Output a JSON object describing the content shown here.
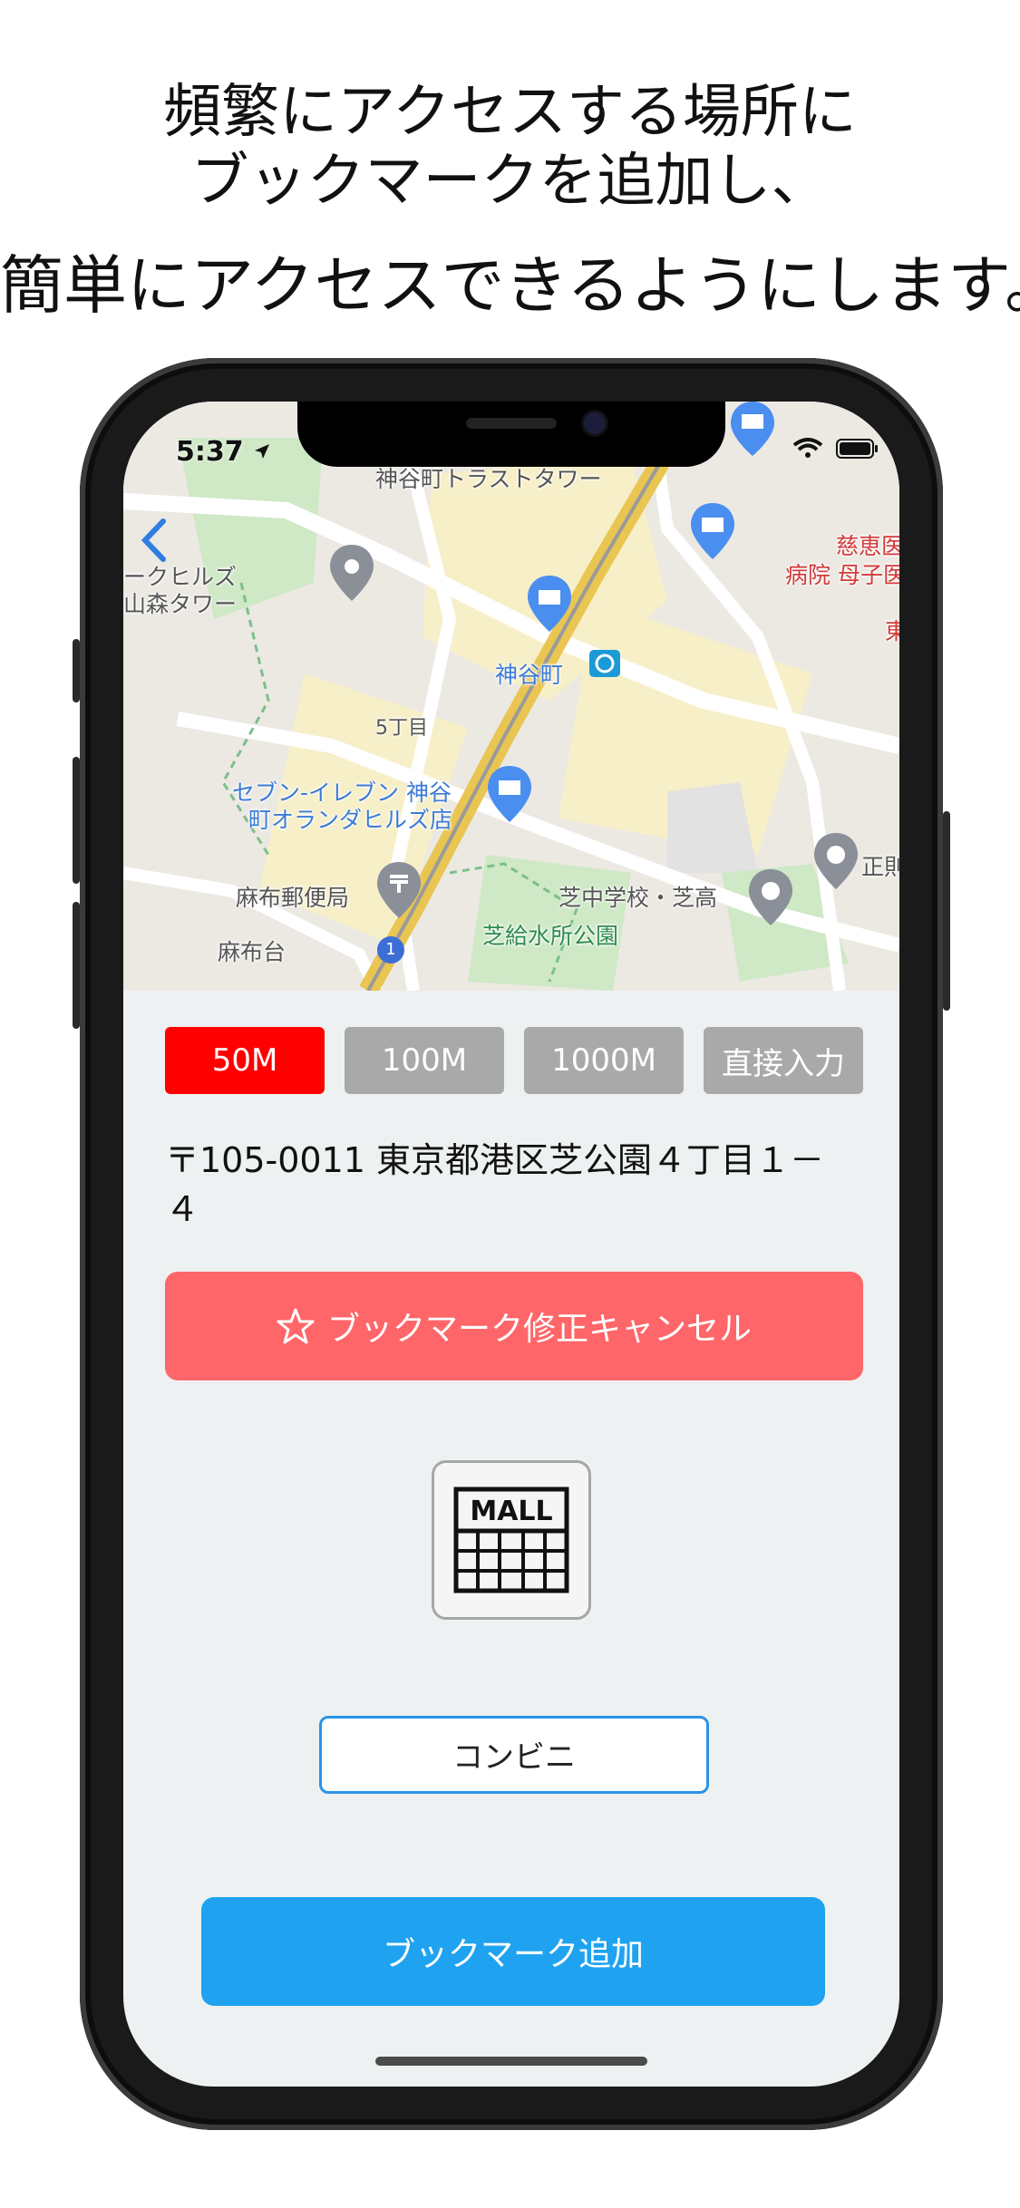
{
  "headline": {
    "line1": "頻繁にアクセスする場所に",
    "line2": "ブックマークを追加し、",
    "line3": "簡単にアクセスできるようにします。"
  },
  "status_bar": {
    "time": "5:37"
  },
  "map": {
    "labels": [
      {
        "id": "tower1",
        "text": "神谷町トラストタワー"
      },
      {
        "id": "hills",
        "text": "ークヒルズ"
      },
      {
        "id": "mori",
        "text": "山森タワー"
      },
      {
        "id": "station",
        "text": "神谷町"
      },
      {
        "id": "chome",
        "text": "5丁目"
      },
      {
        "id": "seven1",
        "text": "セブン-イレブン 神谷"
      },
      {
        "id": "seven2",
        "text": "町オランダヒルズ店"
      },
      {
        "id": "post",
        "text": "麻布郵便局"
      },
      {
        "id": "azabudai",
        "text": "麻布台"
      },
      {
        "id": "school",
        "text": "芝中学校・芝高"
      },
      {
        "id": "park",
        "text": "芝給水所公園"
      },
      {
        "id": "hosp1",
        "text": "慈恵医"
      },
      {
        "id": "hosp2",
        "text": "病院 母子医"
      },
      {
        "id": "east",
        "text": "東"
      },
      {
        "id": "sho",
        "text": "正則"
      },
      {
        "id": "route",
        "text": "1"
      }
    ]
  },
  "radius_options": [
    "50M",
    "100M",
    "1000M",
    "直接入力"
  ],
  "selected_radius": "50M",
  "address": "〒105-0011 東京都港区芝公園４丁目１－４",
  "cancel_button": {
    "label": "ブックマーク修正キャンセル",
    "icon": "star-outline-icon"
  },
  "category_icon": {
    "name": "mall-icon",
    "text": "MALL"
  },
  "category_field": {
    "value": "コンビニ"
  },
  "add_button": {
    "label": "ブックマーク追加"
  },
  "colors": {
    "active_radius": "#ff0000",
    "inactive_radius": "#a9a9a9",
    "cancel": "#ff6669",
    "primary": "#1fa3f0",
    "background": "#eef1f2"
  }
}
